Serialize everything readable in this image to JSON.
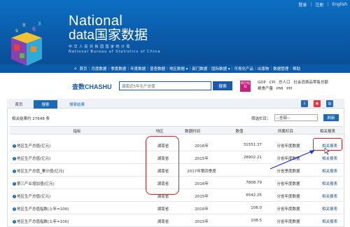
{
  "topbar": {
    "login": "登录",
    "register": "注册",
    "english": "English"
  },
  "logo": {
    "line1": "National",
    "line2": "data国家数据",
    "cn_sub": "中华人民共和国国家统计局",
    "en_sub": "National Bureau of Statistics of China"
  },
  "nav": {
    "items": [
      "首页",
      "月度数据",
      "季度数据",
      "年度数据",
      "普查数据",
      "地区数据 ▾",
      "部门数据",
      "国际数据 ▾",
      "可视化产品",
      "出版物",
      "数据管理",
      "帮助"
    ]
  },
  "search": {
    "brand_prefix": "查数",
    "brand_name": "CHASHU",
    "value": "湖南近5年生产总值",
    "button": "搜索",
    "stat_quick": "统计指标",
    "hot_links": [
      "GDP",
      "CPI",
      "总人口",
      "社会消费品零售总额",
      "粮食产量",
      "PMI",
      "PPI"
    ]
  },
  "tabs": {
    "home": "首页",
    "search": "搜索",
    "result": "搜索结果"
  },
  "tool_icons": [
    "download-icon",
    "weibo-icon",
    "print-icon"
  ],
  "results": {
    "count_text": "相关结果约 27648 条",
    "filter_label": "筛选栏目：",
    "filter_value": "--全部--",
    "refresh": "刷新"
  },
  "table": {
    "headers": {
      "indicator": "指标",
      "region": "地区",
      "time": "数据时间",
      "value": "数值",
      "column": "所属栏目",
      "related": "相关报表"
    },
    "rows": [
      {
        "indicator": "地区生产总值(亿元)",
        "region": "湖南省",
        "time": "2016年",
        "value": "31551.37",
        "column": "分省年度数据",
        "related": "相关报表"
      },
      {
        "indicator": "地区生产总值(亿元)",
        "region": "湖南省",
        "time": "2015年",
        "value": "28902.21",
        "column": "分省年度数据",
        "related": "相关报表"
      },
      {
        "indicator": "地区生产总值_累计值(亿元)",
        "region": "湖南省",
        "time": "2017年第四季度",
        "value": "",
        "column": "分省季度数据",
        "related": "相关报表"
      },
      {
        "indicator": "第三产业增加值(亿元)",
        "region": "湖南省",
        "time": "2016年",
        "value": "7808.79",
        "column": "分省年度数据",
        "related": "相关报表"
      },
      {
        "indicator": "地区生产总值(亿元)",
        "region": "湖南省",
        "time": "2015年",
        "value": "6542.25",
        "column": "分省年度数据",
        "related": "相关报表"
      },
      {
        "indicator": "地区生产总值指数(上年=100)",
        "region": "湖南省",
        "time": "2016年",
        "value": "108.0",
        "column": "分省年度数据",
        "related": "相关报表"
      },
      {
        "indicator": "地区生产总值指数(上年=100)",
        "region": "湖南省",
        "time": "2015年",
        "value": "108.5",
        "column": "分省年度数据",
        "related": "相关报表"
      }
    ]
  },
  "colors": {
    "brand_blue": "#0b5fae",
    "accent_blue": "#1a6ab8",
    "annotation_red": "#e02020",
    "magenta": "#c81d7a"
  }
}
